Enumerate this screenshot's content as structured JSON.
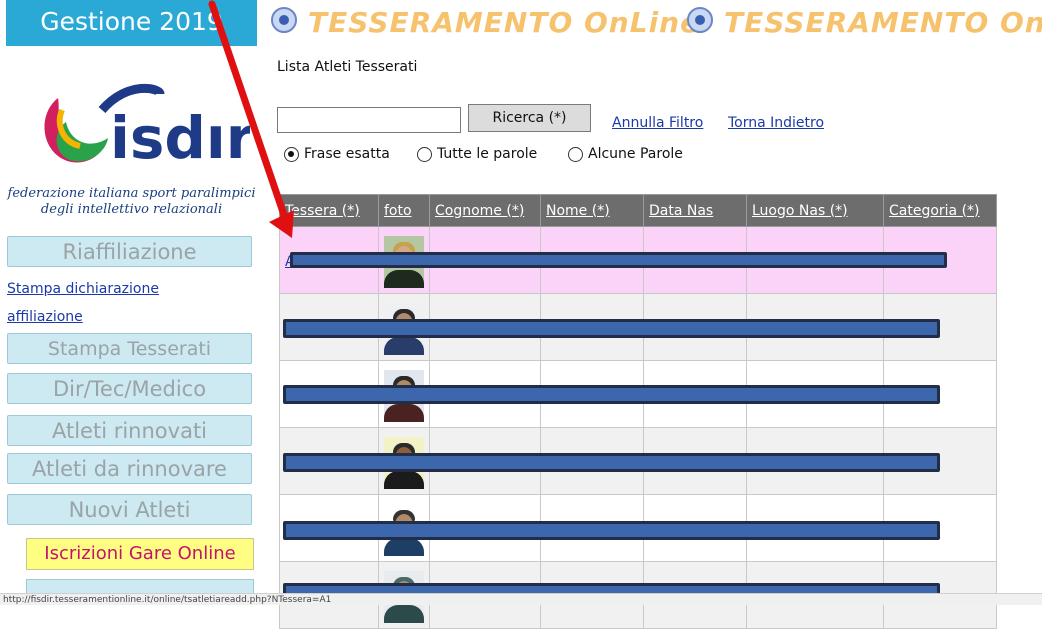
{
  "sidebar": {
    "title": "Gestione 2019",
    "logo_caption": "federazione italiana sport paralimpici degli intellettivo relazionali",
    "buttons": {
      "riaffiliazione": "Riaffiliazione",
      "stampa_tesserati": "Stampa Tesserati",
      "dir_tec_medico": "Dir/Tec/Medico",
      "atleti_rinnovati": "Atleti rinnovati",
      "atleti_da_rinnovare": "Atleti da rinnovare",
      "nuovi_atleti": "Nuovi Atleti",
      "iscrizioni_gare": "Iscrizioni Gare Online"
    },
    "links": {
      "stampa_dichiarazione": "Stampa dichiarazione",
      "affiliazione": "affiliazione"
    }
  },
  "banner": {
    "text": "TESSERAMENTO OnLine"
  },
  "main": {
    "page_title": "Lista Atleti Tesserati",
    "search": {
      "value": "",
      "button_label": "Ricerca (*)"
    },
    "links": {
      "annulla_filtro": "Annulla Filtro",
      "torna_indietro": "Torna Indietro"
    },
    "radio_options": [
      {
        "label": "Frase esatta",
        "checked": true
      },
      {
        "label": "Tutte le parole",
        "checked": false
      },
      {
        "label": "Alcune Parole",
        "checked": false
      }
    ],
    "table": {
      "columns": [
        "Tessera (*)",
        "foto",
        "Cognome (*)",
        "Nome (*)",
        "Data Nas",
        "Luogo Nas (*)",
        "Categoria (*)"
      ],
      "first_row_link": "A"
    }
  },
  "status_bar": {
    "url": "http://fisdir.tesseramentionline.it/online/tsatletiareadd.php?NTessera=A1"
  },
  "colors": {
    "sidebar_title_bg": "#2aa9d6",
    "sidebar_button_bg": "#cde9f1",
    "iscrizioni_bg": "#fffe83",
    "iscrizioni_text": "#c4126e",
    "table_header_bg": "#6d6d6d",
    "highlight_row_bg": "#fbd3f8",
    "redaction_bar": "#3d67ac",
    "annotation_arrow": "#e01010",
    "banner_text": "#f6c26d"
  }
}
